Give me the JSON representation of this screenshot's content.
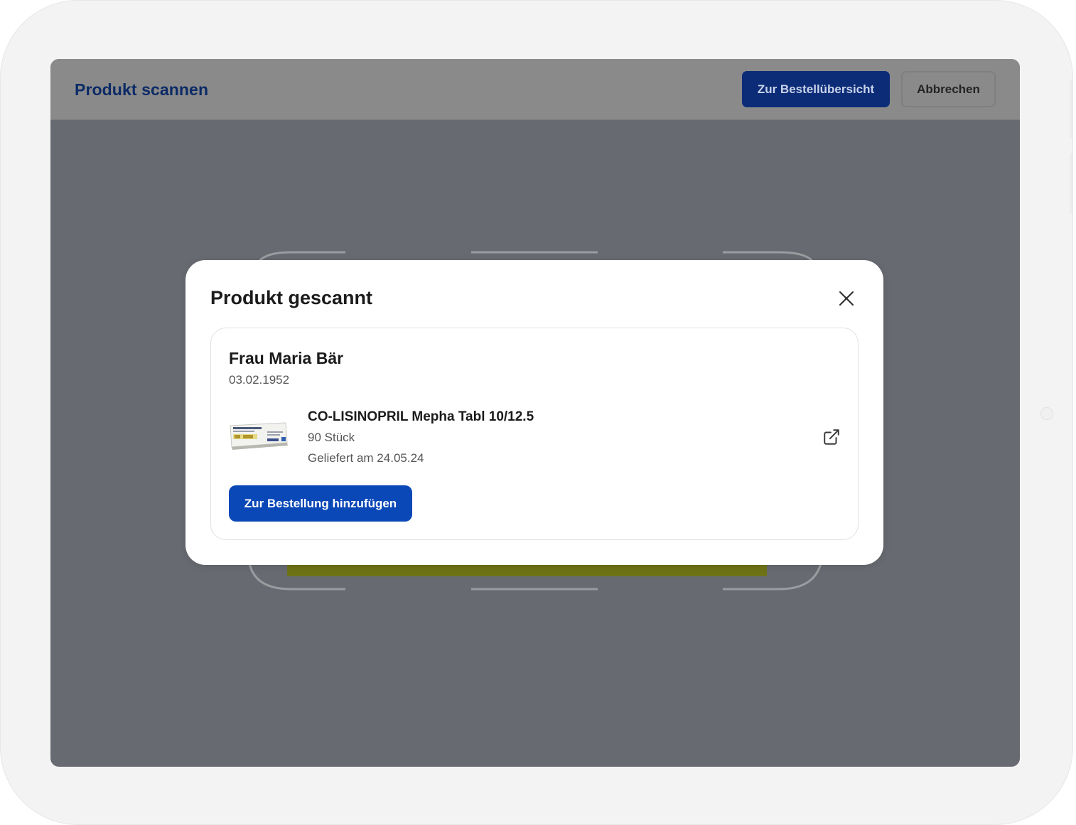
{
  "header": {
    "title": "Produkt scannen",
    "primary_button": "Zur Bestellübersicht",
    "secondary_button": "Abbrechen"
  },
  "modal": {
    "title": "Produkt gescannt",
    "close_icon": "close-icon",
    "patient": {
      "name": "Frau Maria Bär",
      "birthdate": "03.02.1952"
    },
    "product": {
      "name": "CO-LISINOPRIL Mepha Tabl 10/12.5",
      "quantity": "90 Stück",
      "delivered": "Geliefert am 24.05.24",
      "image_icon": "medication-package-image",
      "link_icon": "external-link-icon"
    },
    "add_button": "Zur Bestellung hinzufügen"
  },
  "colors": {
    "primary": "#0b48b7",
    "header_button": "#0c2c78",
    "title_blue": "#0b2a66",
    "overlay": "#676a70"
  }
}
